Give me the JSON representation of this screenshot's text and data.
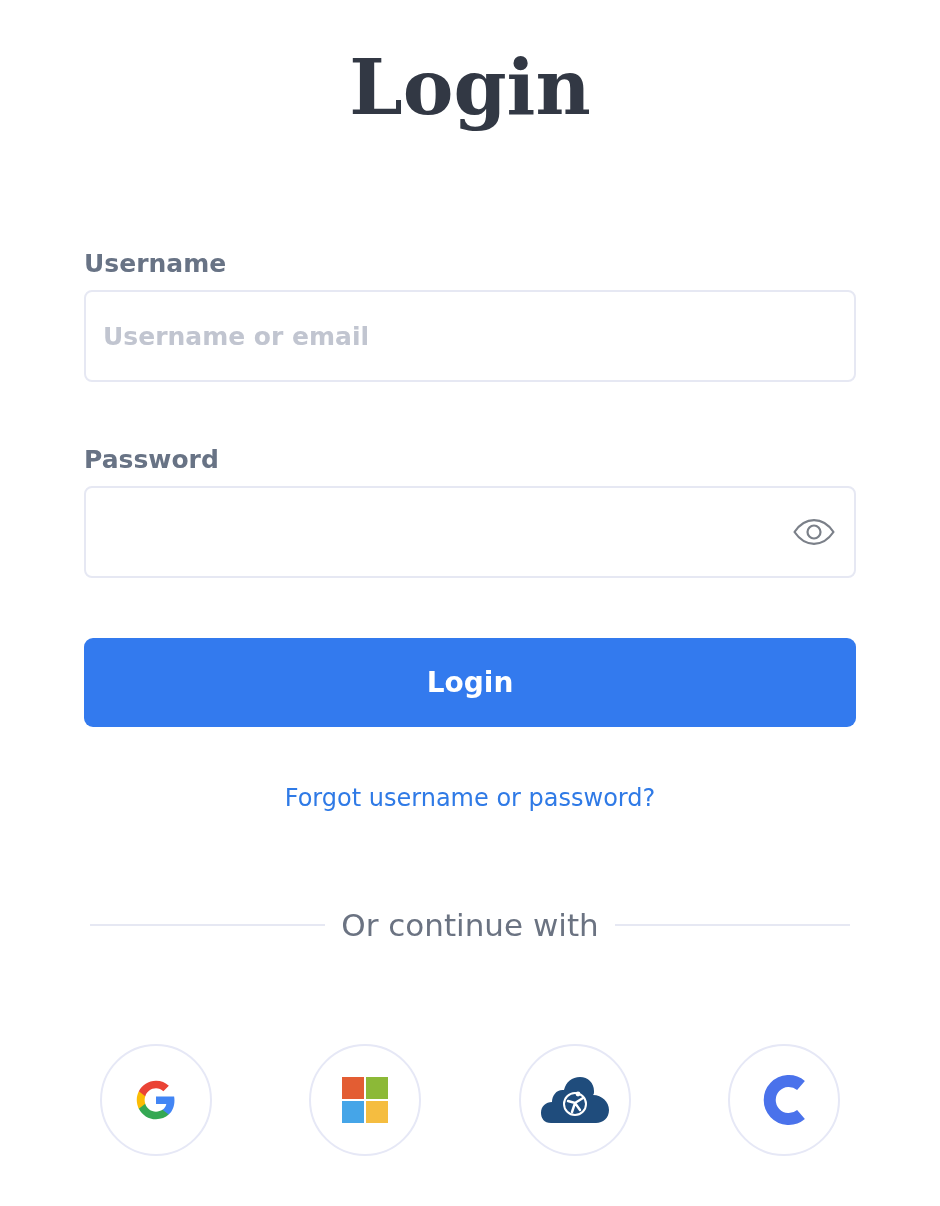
{
  "title": "Login",
  "fields": [
    {
      "kind": "text",
      "label": "Username",
      "placeholder": "Username or email"
    },
    {
      "kind": "password",
      "label": "Password"
    }
  ],
  "login_button": "Login",
  "forgot_link": "Forgot username or password?",
  "divider_text": "Or continue with",
  "social_buttons": [
    {
      "kind": "google"
    },
    {
      "kind": "microsoft"
    },
    {
      "kind": "cloud"
    },
    {
      "kind": "c"
    }
  ]
}
